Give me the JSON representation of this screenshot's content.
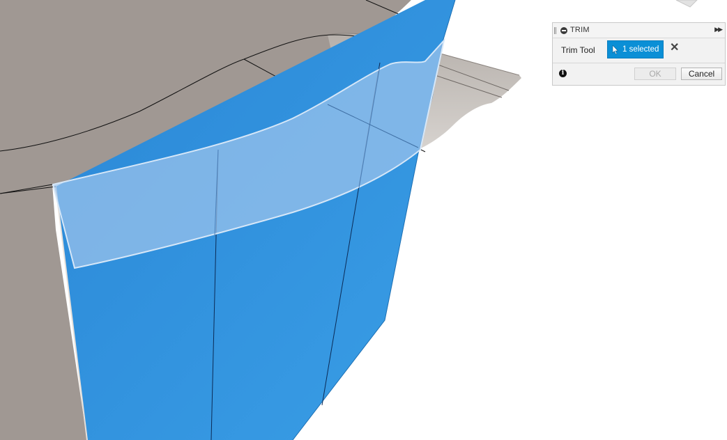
{
  "panel": {
    "title": "TRIM",
    "field_label": "Trim Tool",
    "selection_label": "1 selected",
    "clear_symbol": "✕",
    "info_symbol": "i",
    "ok_label": "OK",
    "cancel_label": "Cancel",
    "ok_enabled": false
  },
  "colors": {
    "body_gray": "#a09893",
    "surface_blue": "#2f8fdb",
    "selected_surface": "#8cb8e6",
    "accent": "#0b8fd6"
  }
}
